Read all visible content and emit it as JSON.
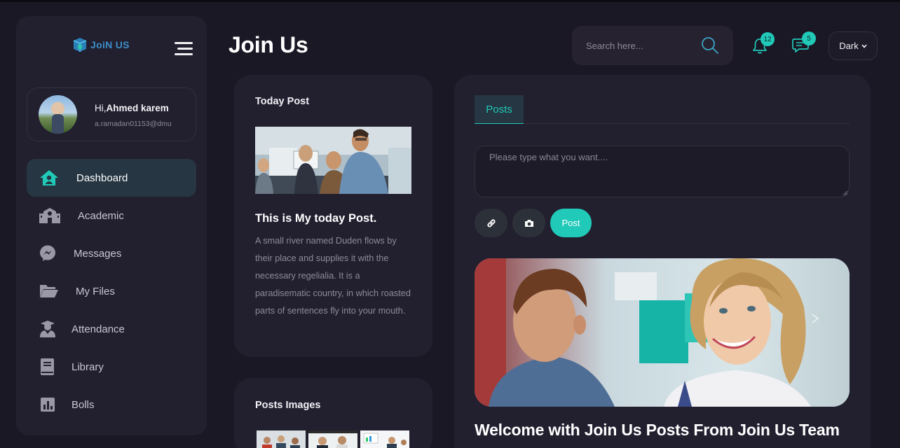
{
  "app": {
    "logo_text": "JoiN US",
    "page_title": "Join Us"
  },
  "user": {
    "greeting": "Hi,",
    "name": "Ahmed karem",
    "email": "a.ramadan01153@dmu"
  },
  "sidebar": {
    "items": [
      {
        "label": "Dashboard",
        "icon": "house-user-icon",
        "active": true
      },
      {
        "label": "Academic",
        "icon": "school-icon"
      },
      {
        "label": "Messages",
        "icon": "messenger-icon"
      },
      {
        "label": "My Files",
        "icon": "folder-open-icon"
      },
      {
        "label": "Attendance",
        "icon": "user-graduate-icon"
      },
      {
        "label": "Library",
        "icon": "book-icon"
      },
      {
        "label": "Bolls",
        "icon": "poll-chart-icon"
      }
    ]
  },
  "header": {
    "search_placeholder": "Search here...",
    "notifications_count": "12",
    "messages_count": "5",
    "theme_label": "Dark"
  },
  "today_post": {
    "title": "Today Post",
    "heading": "This is My today Post.",
    "body": "A small river named Duden flows by their place and supplies it with the necessary regelialia. It is a paradisematic country, in which roasted parts of sentences fly into your mouth."
  },
  "posts_images": {
    "title": "Posts Images"
  },
  "posts": {
    "tab_label": "Posts",
    "composer_placeholder": "Please type what you want....",
    "post_button": "Post",
    "welcome_heading": "Welcome with Join Us Posts From Join Us Team"
  },
  "colors": {
    "accent": "#20c9b8",
    "background": "#1b1825",
    "card": "#221f2f",
    "active_item": "#263642"
  }
}
